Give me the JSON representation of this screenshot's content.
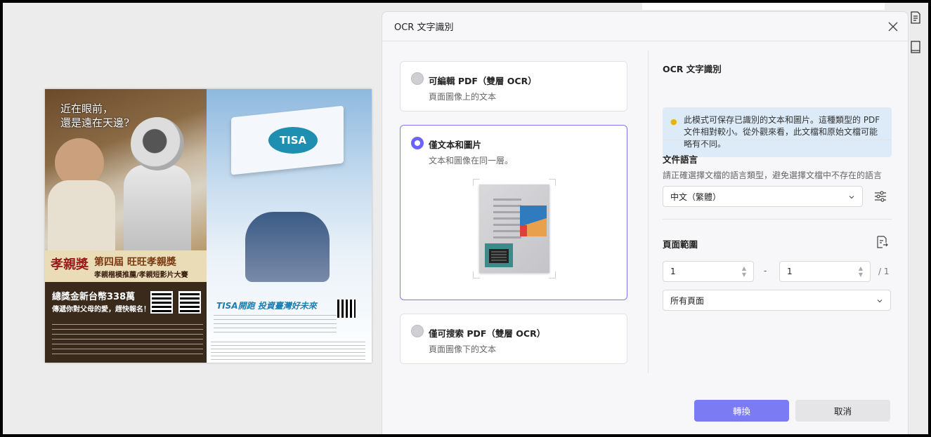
{
  "preview": {
    "left_headline_1": "近在眼前，",
    "left_headline_2": "還是遠在天邊?",
    "left_logo": "孝親獎",
    "left_band_title": "第四屆 旺旺孝親獎",
    "left_band_sub": "孝親楷模推薦/孝親短影片大賽",
    "left_prize_1": "總獎金新台幣338萬",
    "left_prize_2": "傳遞你對父母的愛，趕快報名！",
    "right_brand": "TISA",
    "right_slogan": "TISA開跑 投資臺灣好未來"
  },
  "dialog": {
    "title": "OCR 文字識別",
    "close_label": "✕",
    "options": [
      {
        "title": "可編輯 PDF（雙層 OCR）",
        "subtitle": "頁面圖像上的文本",
        "selected": false
      },
      {
        "title": "僅文本和圖片",
        "subtitle": "文本和圖像在同一層。",
        "selected": true
      },
      {
        "title": "僅可搜索 PDF（雙層 OCR）",
        "subtitle": "頁面圖像下的文本",
        "selected": false
      }
    ],
    "right_panel": {
      "section_title": "OCR 文字識別",
      "info_text": "此模式可保存已識別的文本和圖片。這種類型的 PDF 文件相對較小。從外觀來看，此文檔和原始文檔可能略有不同。",
      "language_title": "文件語言",
      "language_desc": "請正確選擇文檔的語言類型，避免選擇文檔中不存在的語言",
      "language_value": "中文（繁體）",
      "page_range_title": "頁面範圍",
      "range_from": "1",
      "range_separator": "-",
      "range_to": "1",
      "range_total": "/ 1",
      "pages_value": "所有頁面"
    },
    "buttons": {
      "convert": "轉換",
      "cancel": "取消"
    }
  },
  "colors": {
    "accent": "#6c63ff",
    "primary_button": "#7b7bf3",
    "info_bg": "#dcebf7"
  }
}
